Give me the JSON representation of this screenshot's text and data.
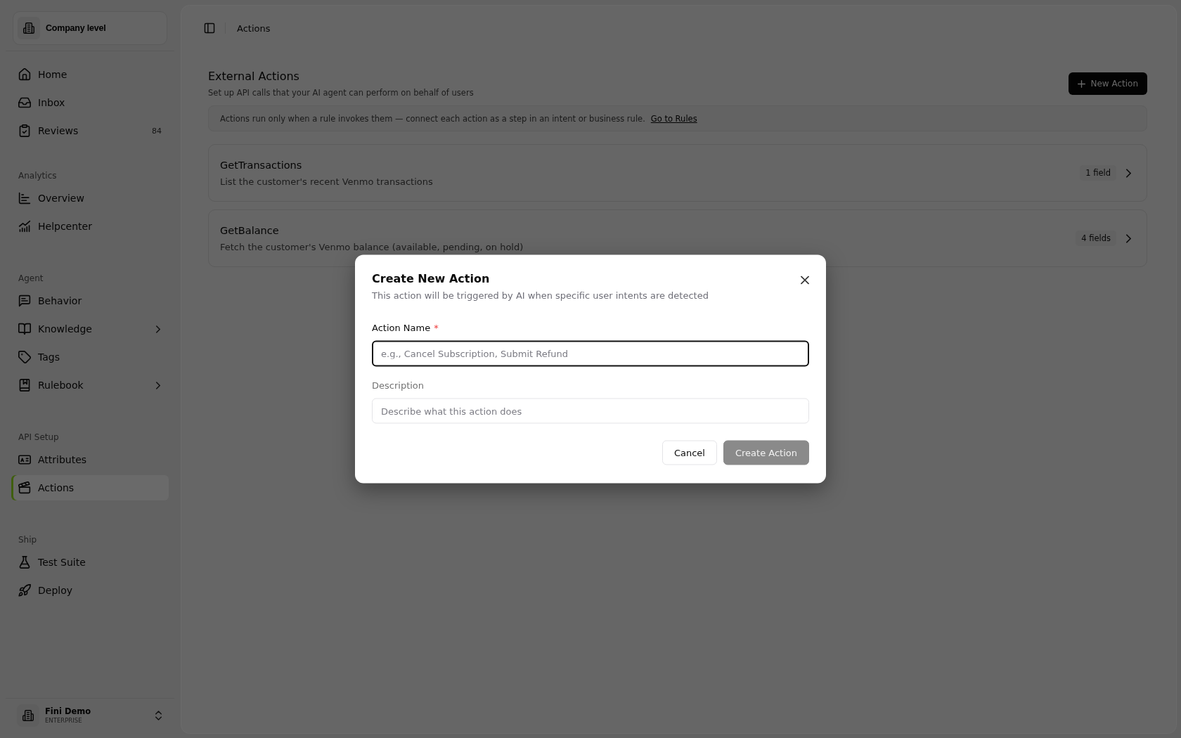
{
  "sidebar": {
    "workspace": {
      "label": "Company level"
    },
    "sections": [
      {
        "items": [
          {
            "label": "Home",
            "selected": false
          },
          {
            "label": "Inbox",
            "selected": false
          },
          {
            "label": "Reviews",
            "selected": false,
            "badge": "84"
          }
        ]
      },
      {
        "label": "Analytics",
        "items": [
          {
            "label": "Overview",
            "selected": false
          },
          {
            "label": "Helpcenter",
            "selected": false
          }
        ]
      },
      {
        "label": "Agent",
        "items": [
          {
            "label": "Behavior",
            "selected": false
          },
          {
            "label": "Knowledge",
            "selected": false,
            "expanded": false
          },
          {
            "label": "Tags",
            "selected": false
          },
          {
            "label": "Rulebook",
            "selected": false,
            "expanded": false
          }
        ]
      },
      {
        "label": "API Setup",
        "items": [
          {
            "label": "Attributes",
            "selected": false
          },
          {
            "label": "Actions",
            "selected": true
          }
        ]
      },
      {
        "label": "Ship",
        "items": [
          {
            "label": "Test Suite",
            "selected": false
          },
          {
            "label": "Deploy",
            "selected": false
          }
        ]
      }
    ],
    "account": {
      "name": "Fini Demo",
      "plan": "ENTERPRISE"
    }
  },
  "header": {
    "breadcrumb": "Actions"
  },
  "page": {
    "title": "External Actions",
    "subtitle": "Set up API calls that your AI agent can perform on behalf of users",
    "new_button": "New Action",
    "notice": {
      "text": "Actions run only when a rule invokes them — connect each action as a step in an intent or business rule.",
      "link": "Go to Rules"
    },
    "actions": [
      {
        "name": "GetTransactions",
        "description": "List the customer's recent Venmo transactions",
        "field_count": "1 field"
      },
      {
        "name": "GetBalance",
        "description": "Fetch the customer's Venmo balance (available, pending, on hold)",
        "field_count": "4 fields"
      }
    ]
  },
  "dialog": {
    "title": "Create New Action",
    "subtitle": "This action will be triggered by AI when specific user intents are detected",
    "fields": [
      {
        "label": "Action Name",
        "required_mark": "*",
        "placeholder": "e.g., Cancel Subscription, Submit Refund",
        "focused": true
      },
      {
        "label": "Description",
        "placeholder": "Describe what this action does",
        "focused": false
      }
    ],
    "buttons": [
      {
        "label": "Cancel",
        "kind": "secondary",
        "disabled": false
      },
      {
        "label": "Create Action",
        "kind": "primary",
        "disabled": true
      }
    ]
  }
}
